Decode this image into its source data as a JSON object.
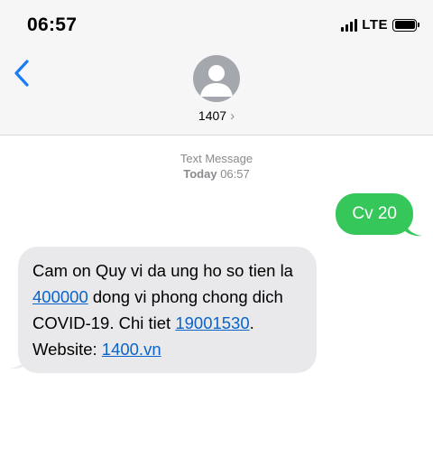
{
  "status_bar": {
    "time": "06:57",
    "network": "LTE"
  },
  "conversation": {
    "contact_name": "1407",
    "chevron": "›"
  },
  "thread_meta": {
    "type": "Text Message",
    "day": "Today",
    "time": "06:57"
  },
  "messages": {
    "sent": {
      "text": "Cv 20"
    },
    "received": {
      "part1": "Cam on Quy vi da ung ho so tien la ",
      "link_amount": "400000",
      "part2": " dong vi phong chong dich COVID-19. Chi tiet ",
      "link_phone": "19001530",
      "part3": ". Website: ",
      "link_website": "1400.vn"
    }
  },
  "colors": {
    "sent_bubble": "#35c759",
    "received_bubble": "#e9e9eb",
    "link": "#0a64c9",
    "accent": "#1a7cf5"
  },
  "icons": [
    "back-chevron-icon",
    "avatar-icon",
    "signal-icon",
    "battery-icon"
  ]
}
